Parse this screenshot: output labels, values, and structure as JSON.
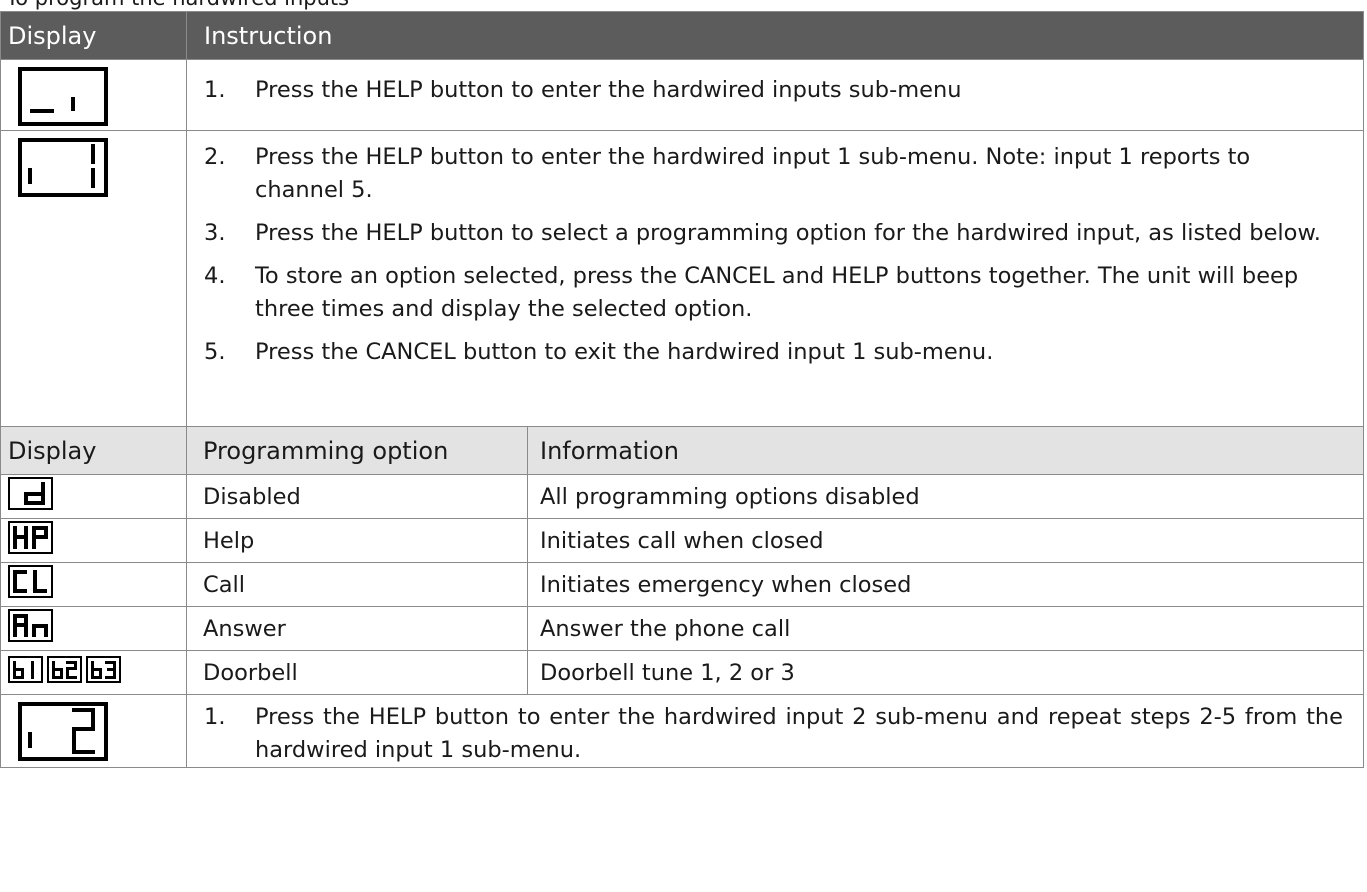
{
  "cut_text": "To program the hardwired inputs",
  "instruction_table": {
    "col_display": "Display",
    "col_instruction": "Instruction",
    "row1": {
      "display_icon": "lcd-display-underscore-i",
      "steps": [
        {
          "num": "1.",
          "text": "Press the HELP button to enter the hardwired inputs sub-menu"
        }
      ]
    },
    "row2": {
      "display_icon": "lcd-display-i-1",
      "steps": [
        {
          "num": "2.",
          "text": "Press the HELP button to enter the hardwired input 1 sub-menu. Note: input 1 reports to channel 5."
        },
        {
          "num": "3.",
          "text": "Press the HELP button to select a programming option for the hardwired input, as listed below."
        },
        {
          "num": "4.",
          "text": "To store an option selected, press the CANCEL and HELP buttons together. The unit will beep three times and display the selected option."
        },
        {
          "num": "5.",
          "text": "Press the CANCEL button to exit the hardwired input 1 sub-menu."
        }
      ]
    }
  },
  "options_table": {
    "col_display": "Display",
    "col_option": "Programming option",
    "col_information": "Information",
    "rows": [
      {
        "display_icon": "lcd-display-d",
        "option": "Disabled",
        "information": "All programming options disabled"
      },
      {
        "display_icon": "lcd-display-HP",
        "option": "Help",
        "information": "Initiates call when closed"
      },
      {
        "display_icon": "lcd-display-CL",
        "option": "Call",
        "information": "Initiates emergency when closed"
      },
      {
        "display_icon": "lcd-display-An",
        "option": "Answer",
        "information": "Answer the phone call"
      },
      {
        "display_icon": "lcd-display-b1-b2-b3",
        "option": "Doorbell",
        "information": "Doorbell tune 1, 2 or 3"
      }
    ]
  },
  "last_row": {
    "display_icon": "lcd-display-i-2",
    "steps": [
      {
        "num": "1.",
        "text": "Press the HELP button to enter the hardwired input 2 sub-menu and repeat steps 2-5 from the hardwired input 1 sub-menu."
      }
    ]
  }
}
